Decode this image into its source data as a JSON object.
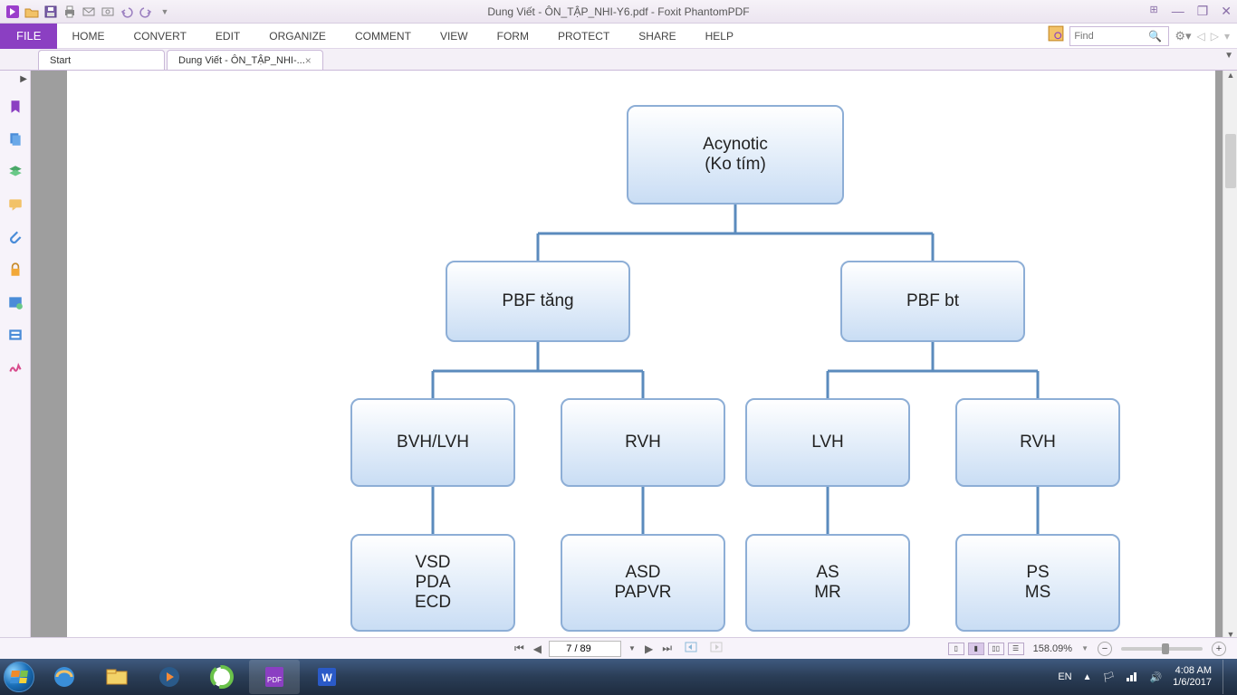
{
  "titlebar": {
    "title": "Dung Viết - ÔN_TẬP_NHI-Y6.pdf - Foxit PhantomPDF"
  },
  "menu": {
    "file": "FILE",
    "items": [
      "HOME",
      "CONVERT",
      "EDIT",
      "ORGANIZE",
      "COMMENT",
      "VIEW",
      "FORM",
      "PROTECT",
      "SHARE",
      "HELP"
    ],
    "find_placeholder": "Find"
  },
  "tabs": {
    "start": "Start",
    "doc": "Dung Viết - ÔN_TẬP_NHI-..."
  },
  "diagram": {
    "root_l1": "Acynotic",
    "root_l2": "(Ko tím)",
    "l2a": "PBF tăng",
    "l2b": "PBF bt",
    "l3a": "BVH/LVH",
    "l3b": "RVH",
    "l3c": "LVH",
    "l3d": "RVH",
    "l4a_1": "VSD",
    "l4a_2": "PDA",
    "l4a_3": "ECD",
    "l4b_1": "ASD",
    "l4b_2": "PAPVR",
    "l4c_1": "AS",
    "l4c_2": "MR",
    "l4d_1": "PS",
    "l4d_2": "MS"
  },
  "status": {
    "page": "7 / 89",
    "zoom": "158.09%"
  },
  "tray": {
    "lang": "EN",
    "time": "4:08 AM",
    "date": "1/6/2017"
  }
}
